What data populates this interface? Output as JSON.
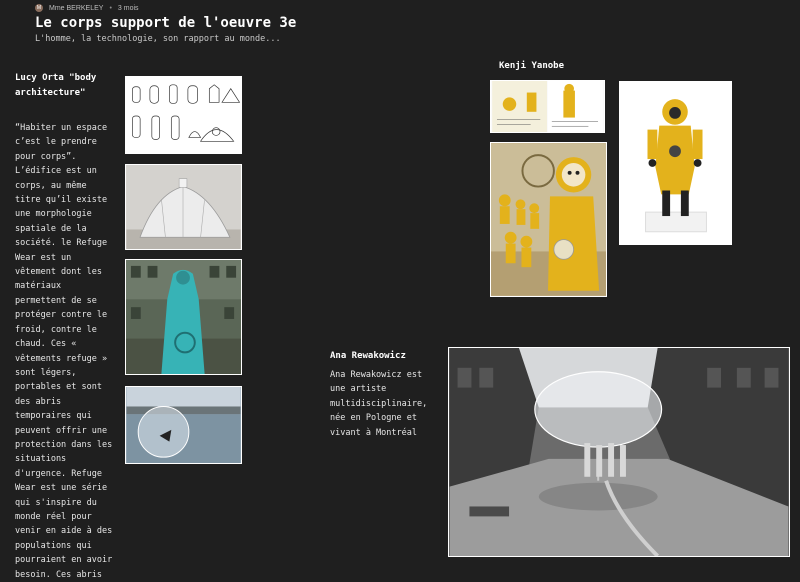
{
  "header": {
    "avatar_initial": "M",
    "author": "Mme BERKELEY",
    "separator": "•",
    "age": "3 mois",
    "title": "Le corps support de l'oeuvre 3e",
    "subtitle": "L'homme, la technologie, son rapport au monde..."
  },
  "sections": {
    "orta": {
      "title": "Lucy Orta \"body\narchitecture\"",
      "body": "“Habiter un espace\nc’est le prendre\npour corps”.\nL’édifice est un\ncorps, au même\ntitre qu’il existe\nune morphologie\nspatiale de la\nsociété. le Refuge\nWear est un\nvêtement dont les\nmatériaux\npermettent de se\nprotéger contre le\nfroid, contre le\nchaud. Ces «\nvêtements refuge »\nsont légers,\nportables et sont\ndes abris\ntemporaires qui\npeuvent offrir une\nprotection dans les\nsituations\nd'urgence. Refuge\nWear est une série\nqui s'inspire du\nmonde réel pour\nvenir en aide à des\npopulations qui\npourraient en avoir\nbesoin. Ces abris"
    },
    "yanobe": {
      "title": "Kenji Yanobe"
    },
    "rewakowicz": {
      "title": "Ana Rewakowicz",
      "body": "Ana Rewakowicz est\nune artiste\nmultidisciplinaire,\nnée en Pologne et\nvivant à Montréal"
    }
  },
  "colors": {
    "background": "#1f1f1f",
    "text": "#e8e8e8",
    "suit_yellow": "#e3b21c"
  }
}
